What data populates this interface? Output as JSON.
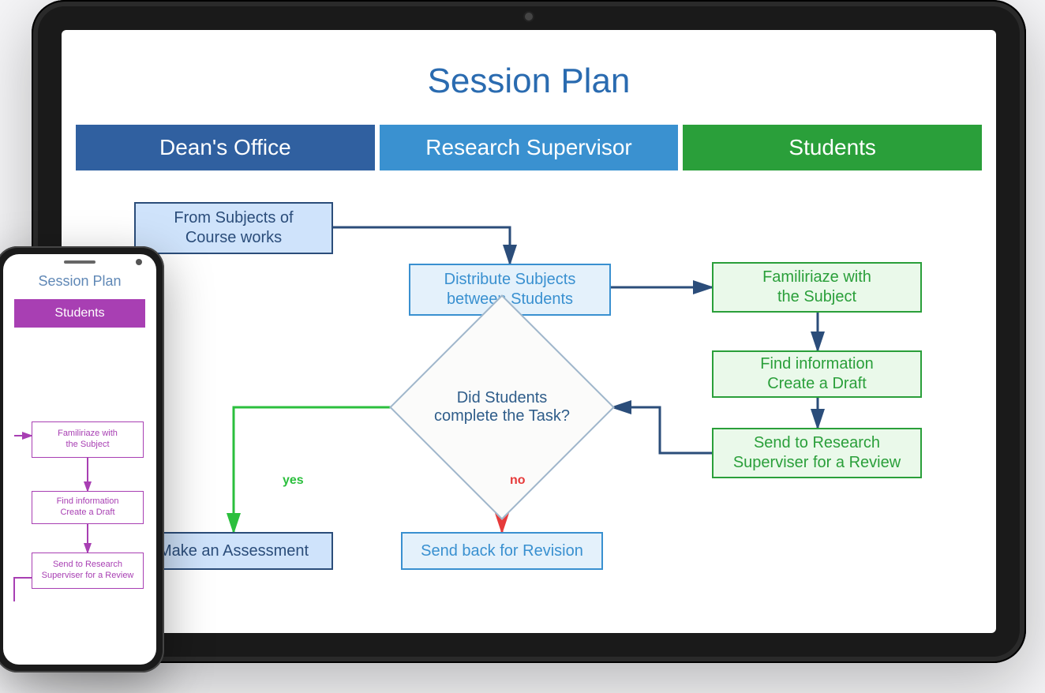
{
  "title": "Session Plan",
  "lanes": {
    "dean": "Dean's Office",
    "supervisor": "Research Supervisor",
    "students": "Students"
  },
  "boxes": {
    "dean_subjects": "From Subjects of\nCourse works",
    "distribute": "Distribute Subjects\nbetween Students",
    "familiarize": "Familiriaze with\nthe Subject",
    "find_info": "Find information\nCreate a Draft",
    "send_review": "Send to Research\nSuperviser for a Review",
    "decision": "Did Students\ncomplete the Task?",
    "make_assessment": "Make an Assessment",
    "send_revision": "Send back for Revision"
  },
  "edge_labels": {
    "yes": "yes",
    "no": "no"
  },
  "phone": {
    "title": "Session Plan",
    "lane": "Students",
    "boxes": {
      "familiarize": "Familiriaze with\nthe Subject",
      "find_info": "Find information\nCreate a Draft",
      "send_review": "Send to Research\nSuperviser for a Review"
    }
  }
}
